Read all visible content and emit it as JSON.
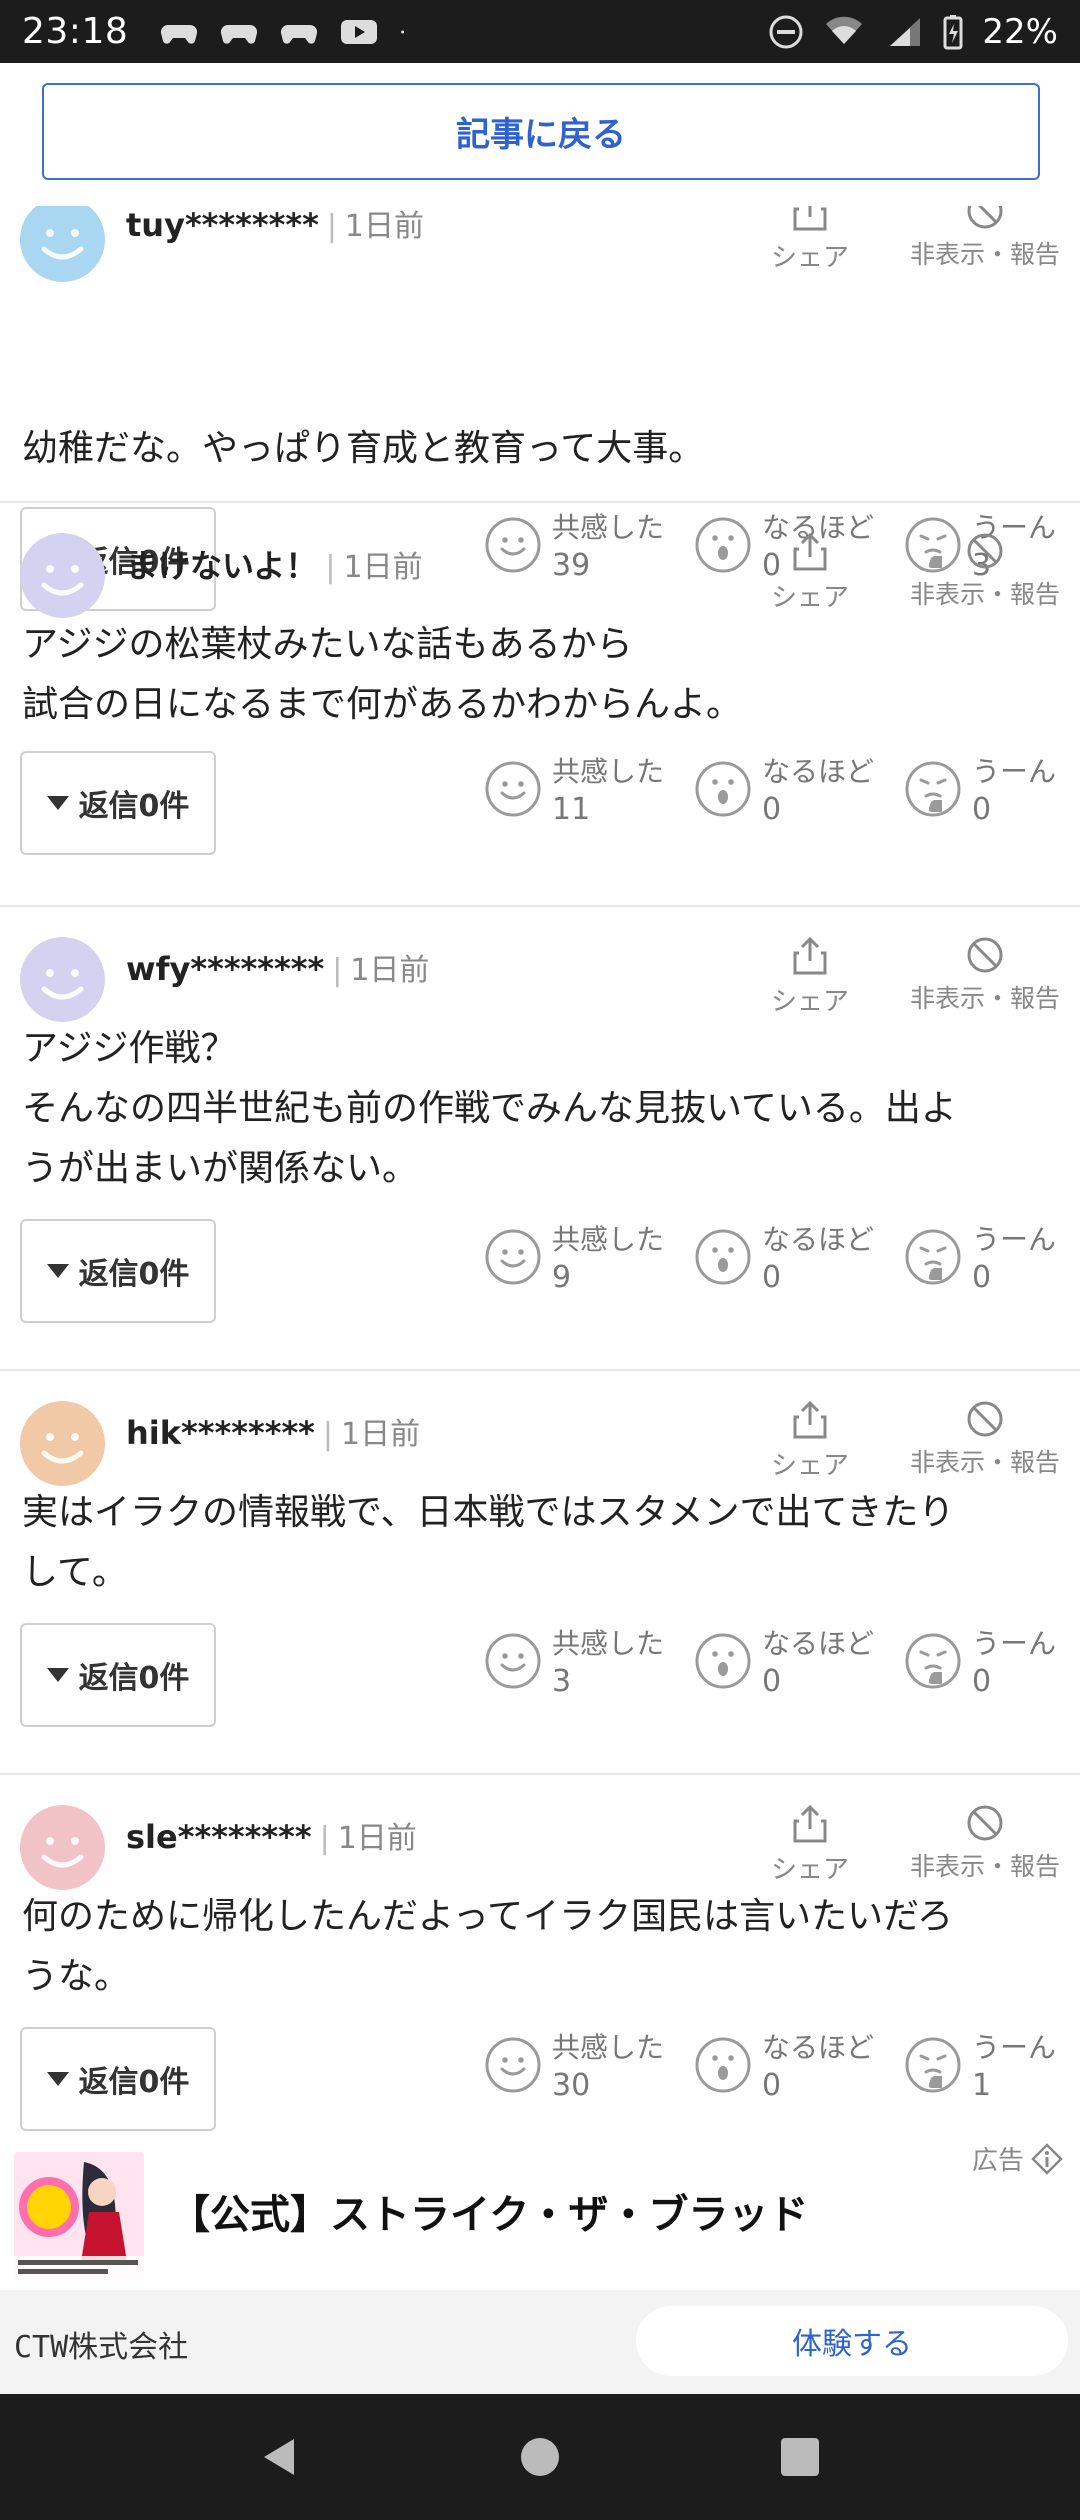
{
  "status": {
    "time": "23:18",
    "battery": "22%",
    "network": "5"
  },
  "back_button": "記事に戻る",
  "labels": {
    "share": "シェア",
    "report": "非表示・報告",
    "sep": "|"
  },
  "comments": [
    {
      "username": "tuy********",
      "time": "1日前",
      "avatar_color": "#a9d6f0",
      "text_lines": [
        "幼稚だな。やっぱり育成と教育って大事。"
      ],
      "reply": "返信0件",
      "reactions": [
        {
          "label": "共感した",
          "count": "39"
        },
        {
          "label": "なるほど",
          "count": "0"
        },
        {
          "label": "うーん",
          "count": "3"
        }
      ]
    },
    {
      "username": "まけないよ！",
      "time": "1日前",
      "avatar_color": "#d5d1f0",
      "text_lines": [
        "アジジの松葉杖みたいな話もあるから",
        "試合の日になるまで何があるかわからんよ。"
      ],
      "reply": "返信0件",
      "reactions": [
        {
          "label": "共感した",
          "count": "11"
        },
        {
          "label": "なるほど",
          "count": "0"
        },
        {
          "label": "うーん",
          "count": "0"
        }
      ]
    },
    {
      "username": "wfy********",
      "time": "1日前",
      "avatar_color": "#d5d1f0",
      "text_lines": [
        "アジジ作戦？",
        "そんなの四半世紀も前の作戦でみんな見抜いている。出よ",
        "うが出まいが関係ない。"
      ],
      "reply": "返信0件",
      "reactions": [
        {
          "label": "共感した",
          "count": "9"
        },
        {
          "label": "なるほど",
          "count": "0"
        },
        {
          "label": "うーん",
          "count": "0"
        }
      ]
    },
    {
      "username": "hik********",
      "time": "1日前",
      "avatar_color": "#f1c9a6",
      "text_lines": [
        "実はイラクの情報戦で、日本戦ではスタメンで出てきたり",
        "して。"
      ],
      "reply": "返信0件",
      "reactions": [
        {
          "label": "共感した",
          "count": "3"
        },
        {
          "label": "なるほど",
          "count": "0"
        },
        {
          "label": "うーん",
          "count": "0"
        }
      ]
    },
    {
      "username": "sle********",
      "time": "1日前",
      "avatar_color": "#f2c3c6",
      "text_lines": [
        "何のために帰化したんだよってイラク国民は言いたいだろ",
        "うな。"
      ],
      "reply": "返信0件",
      "reactions": [
        {
          "label": "共感した",
          "count": "30"
        },
        {
          "label": "なるほど",
          "count": "0"
        },
        {
          "label": "うーん",
          "count": "1"
        }
      ]
    }
  ],
  "ad": {
    "label": "広告",
    "title": "【公式】ストライク・ザ・ブラッド",
    "company": "CTW株式会社",
    "cta": "体験する"
  }
}
